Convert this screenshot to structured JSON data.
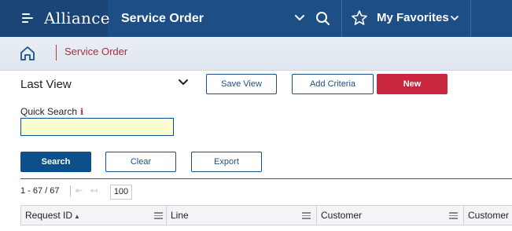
{
  "app": {
    "brand_name": "Alliance",
    "title": "Service Order",
    "favorites_label": "My Favorites"
  },
  "breadcrumb": {
    "current": "Service Order"
  },
  "view": {
    "selected": "Last View",
    "save_view_label": "Save View",
    "add_criteria_label": "Add Criteria",
    "new_label": "New"
  },
  "quick_search": {
    "label": "Quick Search",
    "info_glyph": "i",
    "value": ""
  },
  "actions": {
    "search_label": "Search",
    "clear_label": "Clear",
    "export_label": "Export"
  },
  "pager": {
    "range_text": "1 - 67 / 67",
    "first_glyph": "⇤",
    "prev_glyph": "↤",
    "page_size": "100"
  },
  "grid": {
    "columns": [
      {
        "label": "Request ID",
        "sorted": "asc"
      },
      {
        "label": "Line"
      },
      {
        "label": "Customer"
      },
      {
        "label": "Customer II"
      }
    ]
  },
  "icons": {
    "menu": "hamburger-icon",
    "brand_mark": "alliance-logo",
    "dropdown": "chevron-down-icon",
    "search": "search-icon",
    "star": "star-icon",
    "home": "home-icon",
    "column_menu": "column-menu-icon"
  },
  "colors": {
    "header_blue": "#1d4f86",
    "brand_blue": "#1a4576",
    "accent_red": "#c8273f",
    "input_yellow": "#fbfbd0"
  }
}
